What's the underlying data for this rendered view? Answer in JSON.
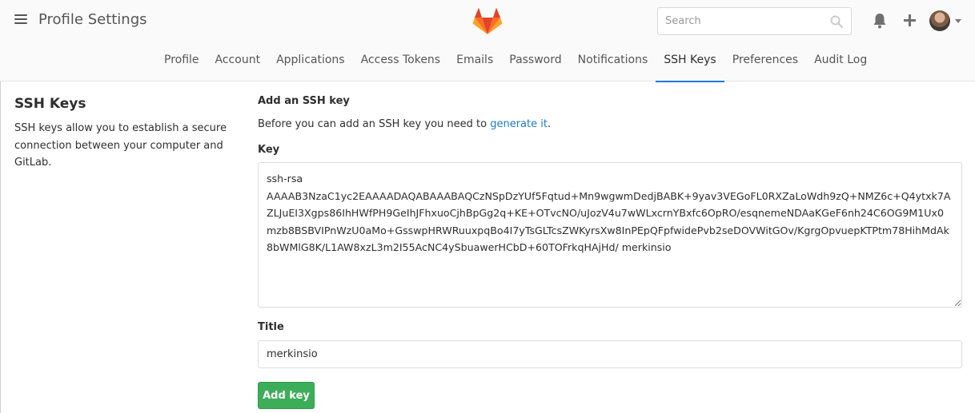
{
  "header": {
    "title": "Profile Settings",
    "menu_icon": "hamburger-icon",
    "logo_icon": "gitlab-tanuki-logo",
    "search": {
      "placeholder": "Search",
      "value": "",
      "icon": "search-icon"
    },
    "icons": [
      "bell-icon",
      "plus-icon",
      "avatar",
      "chevron-down-icon"
    ]
  },
  "tabs": [
    {
      "label": "Profile"
    },
    {
      "label": "Account"
    },
    {
      "label": "Applications"
    },
    {
      "label": "Access Tokens"
    },
    {
      "label": "Emails"
    },
    {
      "label": "Password"
    },
    {
      "label": "Notifications"
    },
    {
      "label": "SSH Keys",
      "active": true
    },
    {
      "label": "Preferences"
    },
    {
      "label": "Audit Log"
    }
  ],
  "sidebar": {
    "title": "SSH Keys",
    "description": "SSH keys allow you to establish a secure connection between your computer and GitLab."
  },
  "form": {
    "heading": "Add an SSH key",
    "intro_prefix": "Before you can add an SSH key you need to ",
    "intro_link": "generate it",
    "intro_suffix": ".",
    "key_label": "Key",
    "key_line1": "ssh-rsa",
    "key_line2": "AAAAB3NzaC1yc2EAAAADAQABAAABAQCzNSpDzYUf5Fqtud+Mn9wgwmDedjBABK+9yav3VEGoFL0RXZaLoWdh9zQ+NMZ6c+Q4ytxk7AZLJuEI3Xgps86IhHWfPH9GeIhJFhxuoCjhBpGg2q+KE+OTvcNO/uJozV4u7wWLxcrnYBxfc6OpRO/esqnemeNDAaKGeF6nh24C6OG9M1Ux0mzb8BSBVIPnWzU0aMo+GsswpHRWRuuxpqBo4I7yTsGLTcsZWKyrsXw8InPEpQFpfwidePvb2seDOVWitGOv/KgrgOpvuepKTPtm78HihMdAk8bWMlG8K/L1AW8xzL3m2I55AcNC4ySbuawerHCbD+60TOFrkqHAjHd/ merkinsio",
    "title_label": "Title",
    "title_value": "merkinsio",
    "submit_label": "Add key",
    "colors": {
      "accent": "#1f78d1",
      "submit": "#3cad58"
    }
  }
}
